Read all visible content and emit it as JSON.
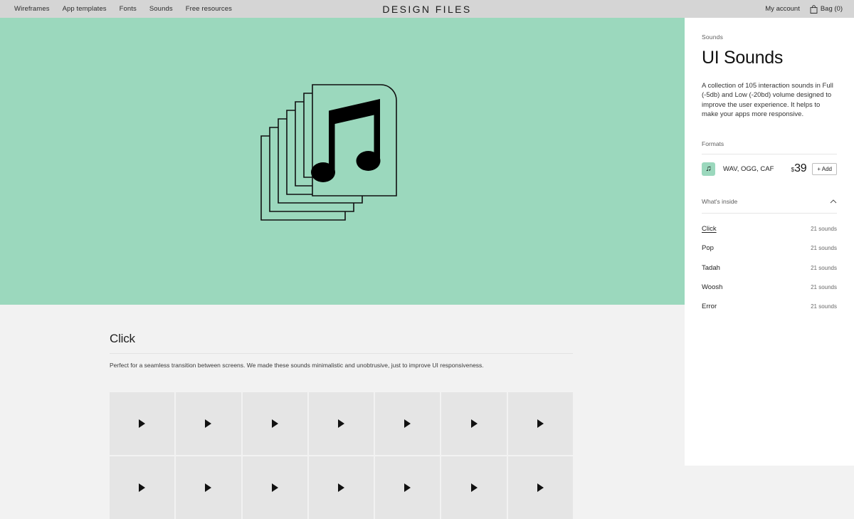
{
  "header": {
    "brand": "DESIGN FILES",
    "nav": [
      {
        "label": "Wireframes"
      },
      {
        "label": "App templates"
      },
      {
        "label": "Fonts"
      },
      {
        "label": "Sounds"
      },
      {
        "label": "Free resources"
      }
    ],
    "account_label": "My account",
    "bag_label": "Bag (0)",
    "bag_icon": "shopping-bag-icon"
  },
  "hero": {
    "illustration": "stacked-cards-music-note-illustration",
    "background_color": "#9bd8bd"
  },
  "panel": {
    "eyebrow": "Sounds",
    "title": "UI Sounds",
    "description": "A collection of 105 interaction sounds in Full (-5db) and Low (-20bd) volume designed to improve the user experience. It helps to make your apps more responsive.",
    "formats_label": "Formats",
    "format": {
      "icon": "music-note-icon",
      "icon_color": "#9bd8bd",
      "name": "WAV, OGG, CAF",
      "currency": "$",
      "price": "39",
      "add_label": "+ Add"
    },
    "inside": {
      "label": "What's inside",
      "toggle_icon": "chevron-up-icon",
      "items": [
        {
          "name": "Click",
          "count": "21 sounds",
          "active": true
        },
        {
          "name": "Pop",
          "count": "21 sounds",
          "active": false
        },
        {
          "name": "Tadah",
          "count": "21 sounds",
          "active": false
        },
        {
          "name": "Woosh",
          "count": "21 sounds",
          "active": false
        },
        {
          "name": "Error",
          "count": "21 sounds",
          "active": false
        }
      ]
    }
  },
  "section": {
    "title": "Click",
    "description": "Perfect for a seamless transition between screens. We made these sounds minimalistic and unobtrusive, just to improve UI responsiveness.",
    "grid": {
      "columns": 7,
      "rows": 2,
      "cell_icon": "play-icon",
      "cell_count": 14
    }
  }
}
